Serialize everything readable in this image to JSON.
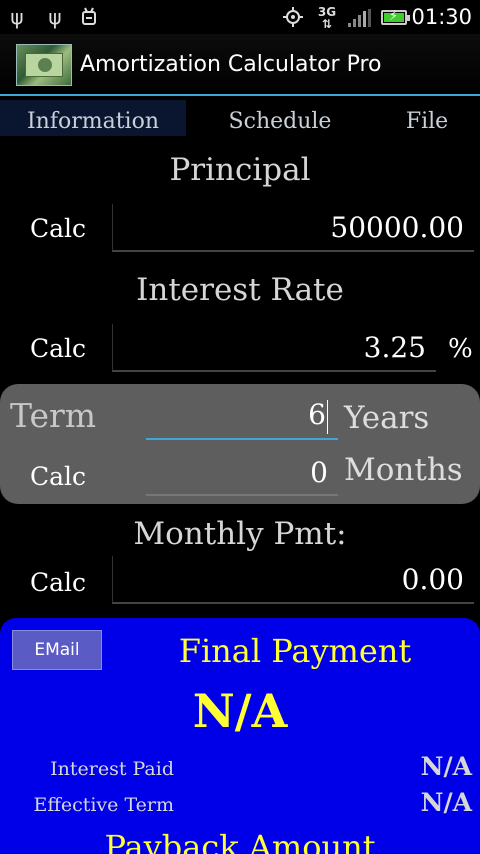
{
  "status": {
    "time": "01:30"
  },
  "app": {
    "title": "Amortization Calculator Pro"
  },
  "tabs": [
    {
      "label": "Information",
      "active": true
    },
    {
      "label": "Schedule",
      "active": false
    },
    {
      "label": "File",
      "active": false
    }
  ],
  "principal": {
    "title": "Principal",
    "calc_label": "Calc",
    "value": "50000.00"
  },
  "interest": {
    "title": "Interest Rate",
    "calc_label": "Calc",
    "value": "3.25",
    "unit": "%"
  },
  "term": {
    "title": "Term",
    "calc_label": "Calc",
    "years": "6",
    "years_unit": "Years",
    "months": "0",
    "months_unit": "Months"
  },
  "monthly": {
    "title": "Monthly Pmt:",
    "calc_label": "Calc",
    "value": "0.00"
  },
  "results": {
    "email_label": "EMail",
    "final_title": "Final Payment",
    "final_value": "N/A",
    "interest_paid_label": "Interest Paid",
    "interest_paid_value": "N/A",
    "effective_term_label": "Effective Term",
    "effective_term_value": "N/A",
    "payback_title": "Payback Amount"
  },
  "colors": {
    "accent": "#3ba9d8",
    "results_bg": "#0000e8",
    "highlight": "#ffff33",
    "battery": "#3dcc2c"
  },
  "icons": [
    "usb-icon",
    "usb-icon",
    "android-debug-icon",
    "gps-icon",
    "3g-data-icon",
    "signal-icon",
    "battery-charging-icon"
  ]
}
